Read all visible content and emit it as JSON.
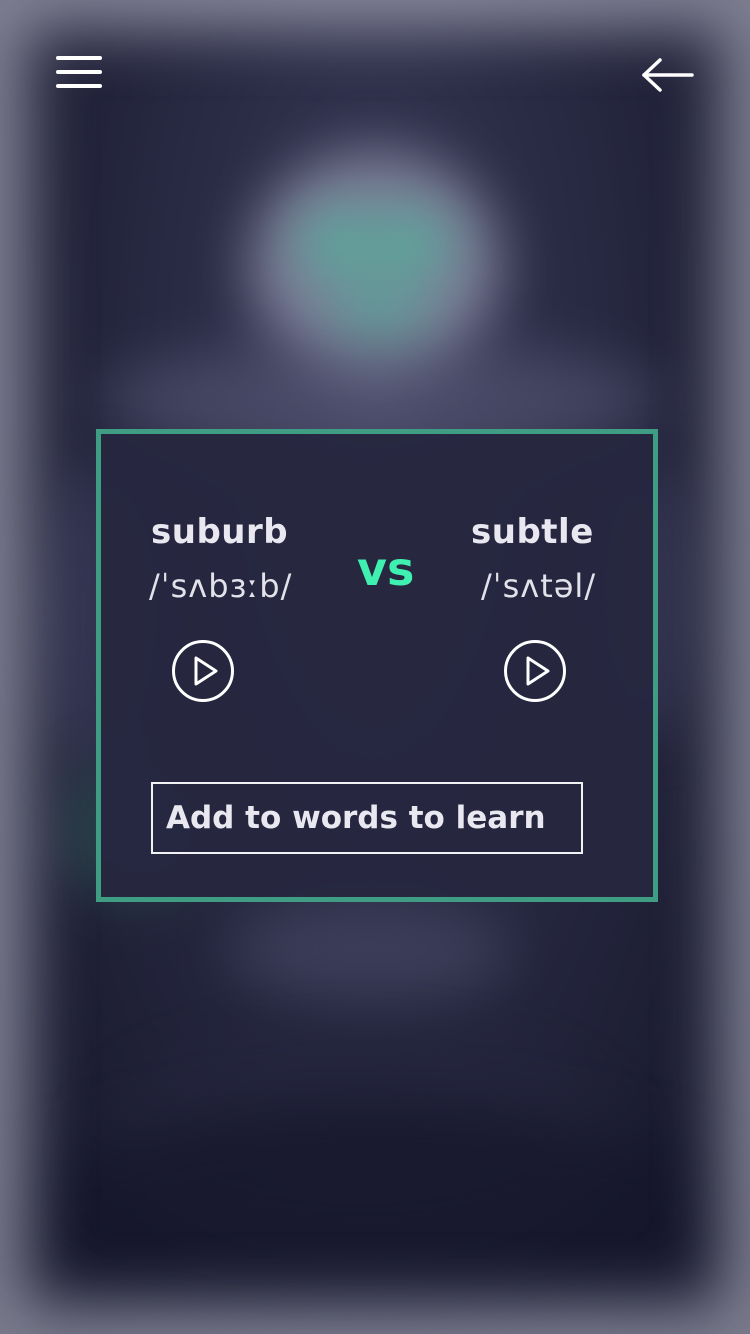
{
  "header": {
    "menu_icon": "hamburger-menu-icon",
    "back_icon": "arrow-left-icon"
  },
  "comparison": {
    "left": {
      "word": "suburb",
      "pronunciation": "/ˈsʌbɜːb/",
      "play_icon": "play-circle-icon"
    },
    "separator": "vs",
    "right": {
      "word": "subtle",
      "pronunciation": "/ˈsʌtəl/",
      "play_icon": "play-circle-icon"
    }
  },
  "actions": {
    "add_label": "Add to words to learn"
  },
  "colors": {
    "accent": "#3ff0b0",
    "card_border": "#3f9d83",
    "card_background": "#262740",
    "text": "#e9e8f0"
  }
}
